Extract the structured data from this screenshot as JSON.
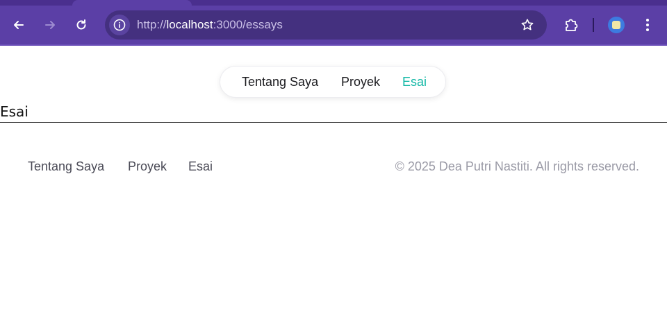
{
  "browser": {
    "url_scheme": "http://",
    "url_host": "localhost",
    "url_path": ":3000/essays",
    "theme_color": "#5b3fa6",
    "icons": {
      "back": "arrow-left-icon",
      "forward": "arrow-right-icon",
      "reload": "reload-icon",
      "site_info": "info-icon",
      "bookmark": "star-icon",
      "extensions": "puzzle-icon",
      "profile": "avatar",
      "menu": "kebab-menu-icon"
    }
  },
  "nav": {
    "items": [
      {
        "label": "Tentang Saya",
        "active": false
      },
      {
        "label": "Proyek",
        "active": false
      },
      {
        "label": "Esai",
        "active": true
      }
    ],
    "active_color": "#14b8a6"
  },
  "page": {
    "heading": "Esai"
  },
  "footer": {
    "links": [
      {
        "label": "Tentang Saya"
      },
      {
        "label": "Proyek"
      },
      {
        "label": "Esai"
      }
    ],
    "copyright": "© 2025 Dea Putri Nastiti. All rights reserved."
  }
}
